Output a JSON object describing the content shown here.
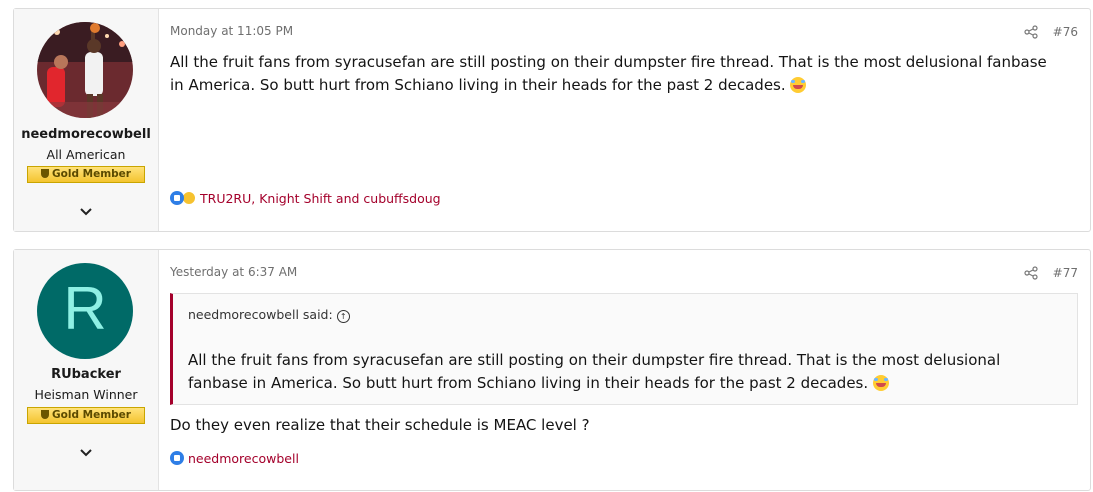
{
  "posts": [
    {
      "author": "needmorecowbell",
      "user_title": "All American",
      "banner": "Gold Member",
      "date": "Monday at 11:05 PM",
      "post_number": "#76",
      "body": "All the fruit fans from syracusefan are still posting on their dumpster fire thread. That is the most delusional fanbase in America. So butt hurt from Schiano living in their heads for the past 2 decades.",
      "reactions": "TRU2RU, Knight Shift and cubuffsdoug"
    },
    {
      "author": "RUbacker",
      "avatar_letter": "R",
      "user_title": "Heisman Winner",
      "banner": "Gold Member",
      "date": "Yesterday at 6:37 AM",
      "post_number": "#77",
      "quote_author": "needmorecowbell said:",
      "quote_body": "All the fruit fans from syracusefan are still posting on their dumpster fire thread. That is the most delusional fanbase in America. So butt hurt from Schiano living in their heads for the past 2 decades.",
      "body": "Do they even realize that their schedule is MEAC level ?",
      "reactions": "needmorecowbell"
    }
  ],
  "colors": {
    "accent": "#a4002b",
    "avatar_bg": "#006a67",
    "banner_gold": "#f4c430"
  },
  "icons": [
    "share-icon",
    "chevron-down-icon",
    "like-reaction-icon",
    "laugh-reaction-icon",
    "laughing-emoji-icon",
    "quote-jump-icon"
  ]
}
